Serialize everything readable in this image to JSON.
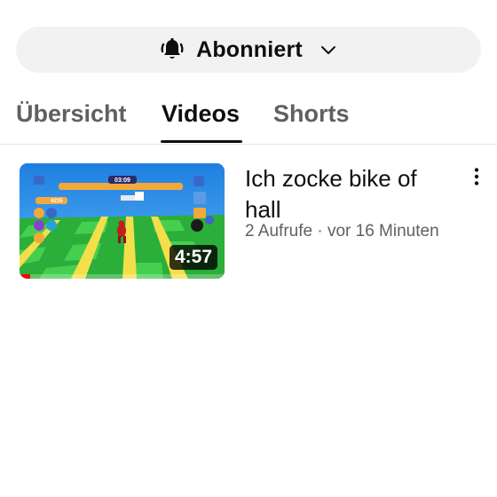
{
  "subscribe": {
    "label": "Abonniert",
    "bell_icon": "bell-ringing-icon",
    "chevron_icon": "chevron-down-icon"
  },
  "tabs": [
    {
      "label": "Übersicht",
      "active": false
    },
    {
      "label": "Videos",
      "active": true
    },
    {
      "label": "Shorts",
      "active": false
    }
  ],
  "videos": [
    {
      "title": "Ich zocke bike of hall",
      "views": "2 Aufrufe",
      "separator": "·",
      "age": "vor 16 Minuten",
      "duration": "4:57",
      "watched_fraction": 0.05,
      "thumbnail_timer": "03:09",
      "thumbnail_score": "6235",
      "more_icon": "more-vert-icon"
    }
  ],
  "colors": {
    "pill_bg": "#f2f2f2",
    "text_primary": "#0f0f0f",
    "text_secondary": "#606060",
    "progress_red": "#ff0000"
  }
}
